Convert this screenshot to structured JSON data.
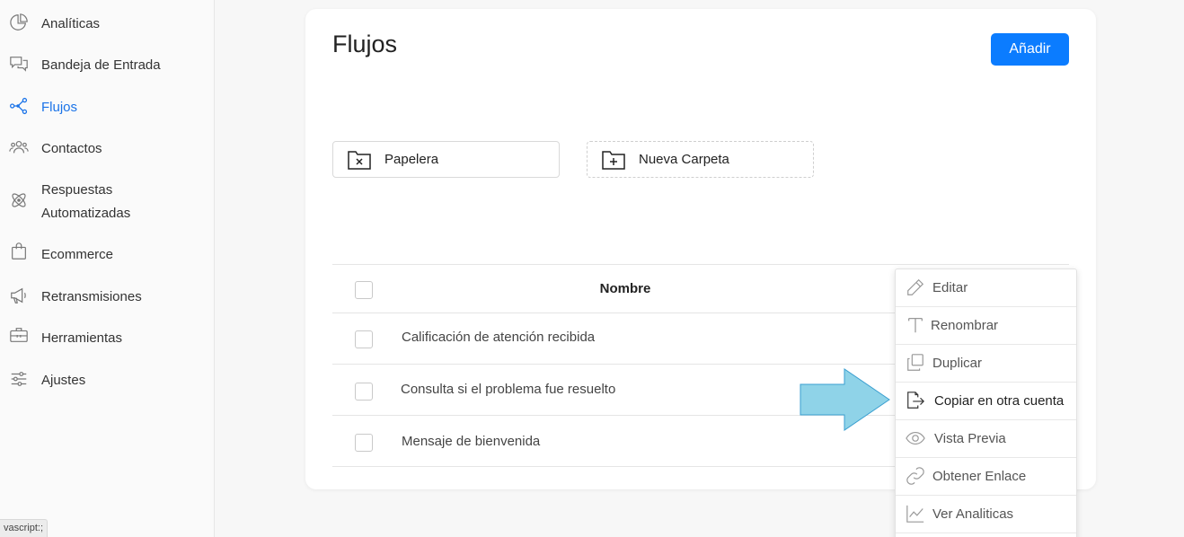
{
  "sidebar": {
    "items": [
      {
        "label": "Analíticas",
        "icon": "pie-chart-icon"
      },
      {
        "label": "Bandeja de Entrada",
        "icon": "chat-bubbles-icon"
      },
      {
        "label": "Flujos",
        "icon": "flow-icon",
        "active": true
      },
      {
        "label": "Contactos",
        "icon": "users-icon"
      },
      {
        "label": "Respuestas",
        "label2": "Automatizadas",
        "icon": "atom-icon"
      },
      {
        "label": "Ecommerce",
        "icon": "shopping-bag-icon"
      },
      {
        "label": "Retransmisiones",
        "icon": "megaphone-icon"
      },
      {
        "label": "Herramientas",
        "icon": "toolbox-icon"
      },
      {
        "label": "Ajustes",
        "icon": "sliders-icon"
      }
    ]
  },
  "status_bar": {
    "text": "vascript:;"
  },
  "main": {
    "title": "Flujos",
    "add_button": "Añadir",
    "folders": [
      {
        "label": "Papelera",
        "icon": "folder-x-icon"
      },
      {
        "label": "Nueva Carpeta",
        "icon": "folder-plus-icon"
      }
    ],
    "table": {
      "header": "Nombre",
      "rows": [
        "Calificación de atención recibida",
        "Consulta si el problema fue resuelto",
        "Mensaje de bienvenida"
      ]
    }
  },
  "context_menu": {
    "items": [
      {
        "label": "Editar",
        "icon": "pencil-icon"
      },
      {
        "label": "Renombrar",
        "icon": "text-t-icon"
      },
      {
        "label": "Duplicar",
        "icon": "copy-icon"
      },
      {
        "label": "Copiar en otra cuenta",
        "icon": "file-export-icon",
        "highlighted": true
      },
      {
        "label": "Vista Previa",
        "icon": "eye-icon"
      },
      {
        "label": "Obtener Enlace",
        "icon": "link-icon"
      },
      {
        "label": "Ver Analiticas",
        "icon": "line-chart-icon"
      }
    ]
  },
  "colors": {
    "accent": "#0b7cff",
    "active_nav": "#1a73e8",
    "arrow_fill": "#8fd3e8",
    "arrow_stroke": "#3a9fd0"
  }
}
